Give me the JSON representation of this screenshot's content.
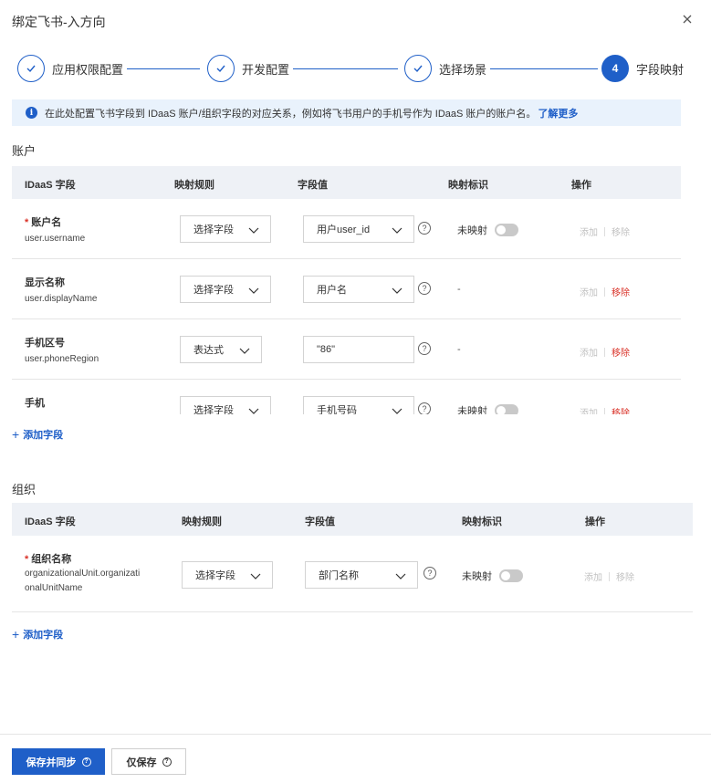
{
  "dialog": {
    "title": "绑定飞书-入方向"
  },
  "steps": [
    {
      "label": "应用权限配置",
      "state": "done"
    },
    {
      "label": "开发配置",
      "state": "done"
    },
    {
      "label": "选择场景",
      "state": "done"
    },
    {
      "number": "4",
      "label": "字段映射",
      "state": "active"
    }
  ],
  "notice": {
    "text": "在此处配置飞书字段到 IDaaS 账户/组织字段的对应关系，例如将飞书用户的手机号作为 IDaaS 账户的账户名。",
    "link": "了解更多"
  },
  "columns": {
    "field": "IDaaS 字段",
    "rule": "映射规则",
    "value": "字段值",
    "flag": "映射标识",
    "ops": "操作"
  },
  "account": {
    "title": "账户",
    "rows": [
      {
        "name": "账户名",
        "key": "user.username",
        "required": true,
        "rule": "选择字段",
        "value": "用户user_id",
        "value_type": "select",
        "flag": "未映射",
        "flag_type": "toggle",
        "add": "添加",
        "remove": "移除",
        "remove_enabled": false
      },
      {
        "name": "显示名称",
        "key": "user.displayName",
        "required": false,
        "rule": "选择字段",
        "value": "用户名",
        "value_type": "select",
        "flag": "-",
        "flag_type": "dash",
        "add": "添加",
        "remove": "移除",
        "remove_enabled": true
      },
      {
        "name": "手机区号",
        "key": "user.phoneRegion",
        "required": false,
        "rule": "表达式",
        "value": "\"86\"",
        "value_type": "input",
        "flag": "-",
        "flag_type": "dash",
        "add": "添加",
        "remove": "移除",
        "remove_enabled": true
      },
      {
        "name": "手机",
        "key": "",
        "required": false,
        "rule": "选择字段",
        "value": "手机号码",
        "value_type": "select",
        "flag": "未映射",
        "flag_type": "toggle",
        "add": "添加",
        "remove": "移除",
        "remove_enabled": true
      }
    ],
    "add_field": "添加字段"
  },
  "organization": {
    "title": "组织",
    "rows": [
      {
        "name": "组织名称",
        "key_line1": "organizationalUnit.organizati",
        "key_line2": "onalUnitName",
        "required": true,
        "rule": "选择字段",
        "value": "部门名称",
        "flag": "未映射",
        "add": "添加",
        "remove": "移除"
      }
    ],
    "add_field": "添加字段"
  },
  "footer": {
    "save_sync": "保存并同步",
    "save_only": "仅保存"
  },
  "colors": {
    "primary": "#1f5fc8",
    "danger": "#d93026",
    "disabled": "#c2c2c2",
    "notice_bg": "#e9f2fc",
    "header_bg": "#eef1f6"
  }
}
